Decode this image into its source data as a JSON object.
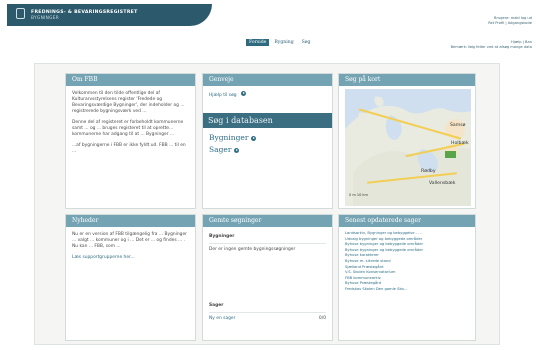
{
  "header": {
    "logo_line1": "FREDNINGS- & BEVARINGSREGISTRET",
    "logo_line2": "BYGNINGER",
    "user_line1": "Brugere: mabl  log ud",
    "user_line2": "Ret Profil | Adgangskode",
    "help_line1": "Hjælp | Ban",
    "help_line2": "Bemærk: følg felter ved at afsøg mange data"
  },
  "nav": {
    "items": [
      {
        "label": "Forside",
        "active": true
      },
      {
        "label": "Bygning",
        "active": false
      },
      {
        "label": "Søg",
        "active": false
      }
    ]
  },
  "panels": {
    "about": {
      "title": "Om FBB",
      "para1": "Velkommen til den tilde offentlige del af Kulturarvsstyrelsens register 'Fredede og Bevaringsværdige Bygninger', der indeholder og ... registrerede bygningsværk ved ... ",
      "para2": "Denne del af registeret er forbeholdt kommunerne samt ... og ... bruges registeret til at oprette... kommunerne har adgang til at ... Bygninger ...",
      "para3": "...af bygningerne i FBB er ikke fyldt ud. FBB ... til en ..."
    },
    "genveje": {
      "title": "Genveje",
      "help_link": "Hjælp til søg",
      "search_title": "Søg i databasen",
      "link1": "Bygninger",
      "link2": "Sager"
    },
    "map": {
      "title": "Søg på kort",
      "labels": [
        "Samsø",
        "Rødby",
        "Holbæk",
        "Vallensbæk",
        "Roskilde",
        "Frederiksberg",
        "København"
      ],
      "scale": "0 m   10 km"
    },
    "news": {
      "title": "Nyheder",
      "text": "Nu er en version af FBB tilgængelig fra ... Bygninger ... valgt ... kommuner og i ... Det er ... og findes ... . Nu kan ... FBB, som ...",
      "link": "Læs supportgrupperne her..."
    },
    "recent": {
      "title": "Gemte søgninger",
      "sub1": "Bygninger",
      "text1": "Der er ingen gemte bygningssøgninger",
      "sub2": "Sager",
      "sag_label": "Ny en sager",
      "sag_value": "0/0"
    },
    "latest": {
      "title": "Senest opdaterede sager",
      "items": [
        "Landsarkiv, Bygninger og bebyggelse - ...",
        "Udvalg bygninger og bebyggede områder",
        "Byhuse bygninger og bebyggede områder",
        "Byhuse bygninger og bebyggede områder",
        "Byhuse karakterer",
        "Byhuse m. sikrede stand",
        "Sjælland Præstegård",
        "V.S. Skolen Konservatorium",
        "FBB kommunearkiv",
        "Byhuse Præstegård",
        "Fredskov Skolen Den gamle Sko..."
      ]
    }
  },
  "colors": {
    "header": "#74a4b3",
    "dark_band": "#3c6e82",
    "logo": "#2c5a6c",
    "link": "#2f6e85"
  }
}
